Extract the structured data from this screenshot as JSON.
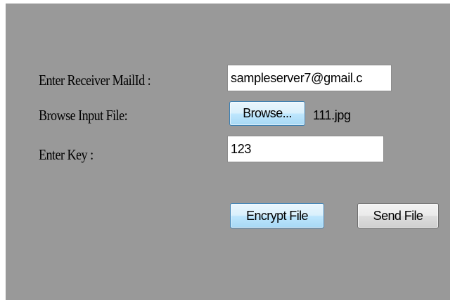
{
  "form": {
    "receiver_label": "Enter Receiver MailId :",
    "receiver_value": "sampleserver7@gmail.c",
    "file_label": "Browse Input File:",
    "browse_label": "Browse...",
    "file_name": "111.jpg",
    "key_label": "Enter Key :",
    "key_value": "123"
  },
  "actions": {
    "encrypt_label": "Encrypt File",
    "send_label": "Send File"
  },
  "colors": {
    "panel_background": "#999999",
    "page_background": "#ffffff",
    "focused_button_border": "#3c7fb1"
  }
}
